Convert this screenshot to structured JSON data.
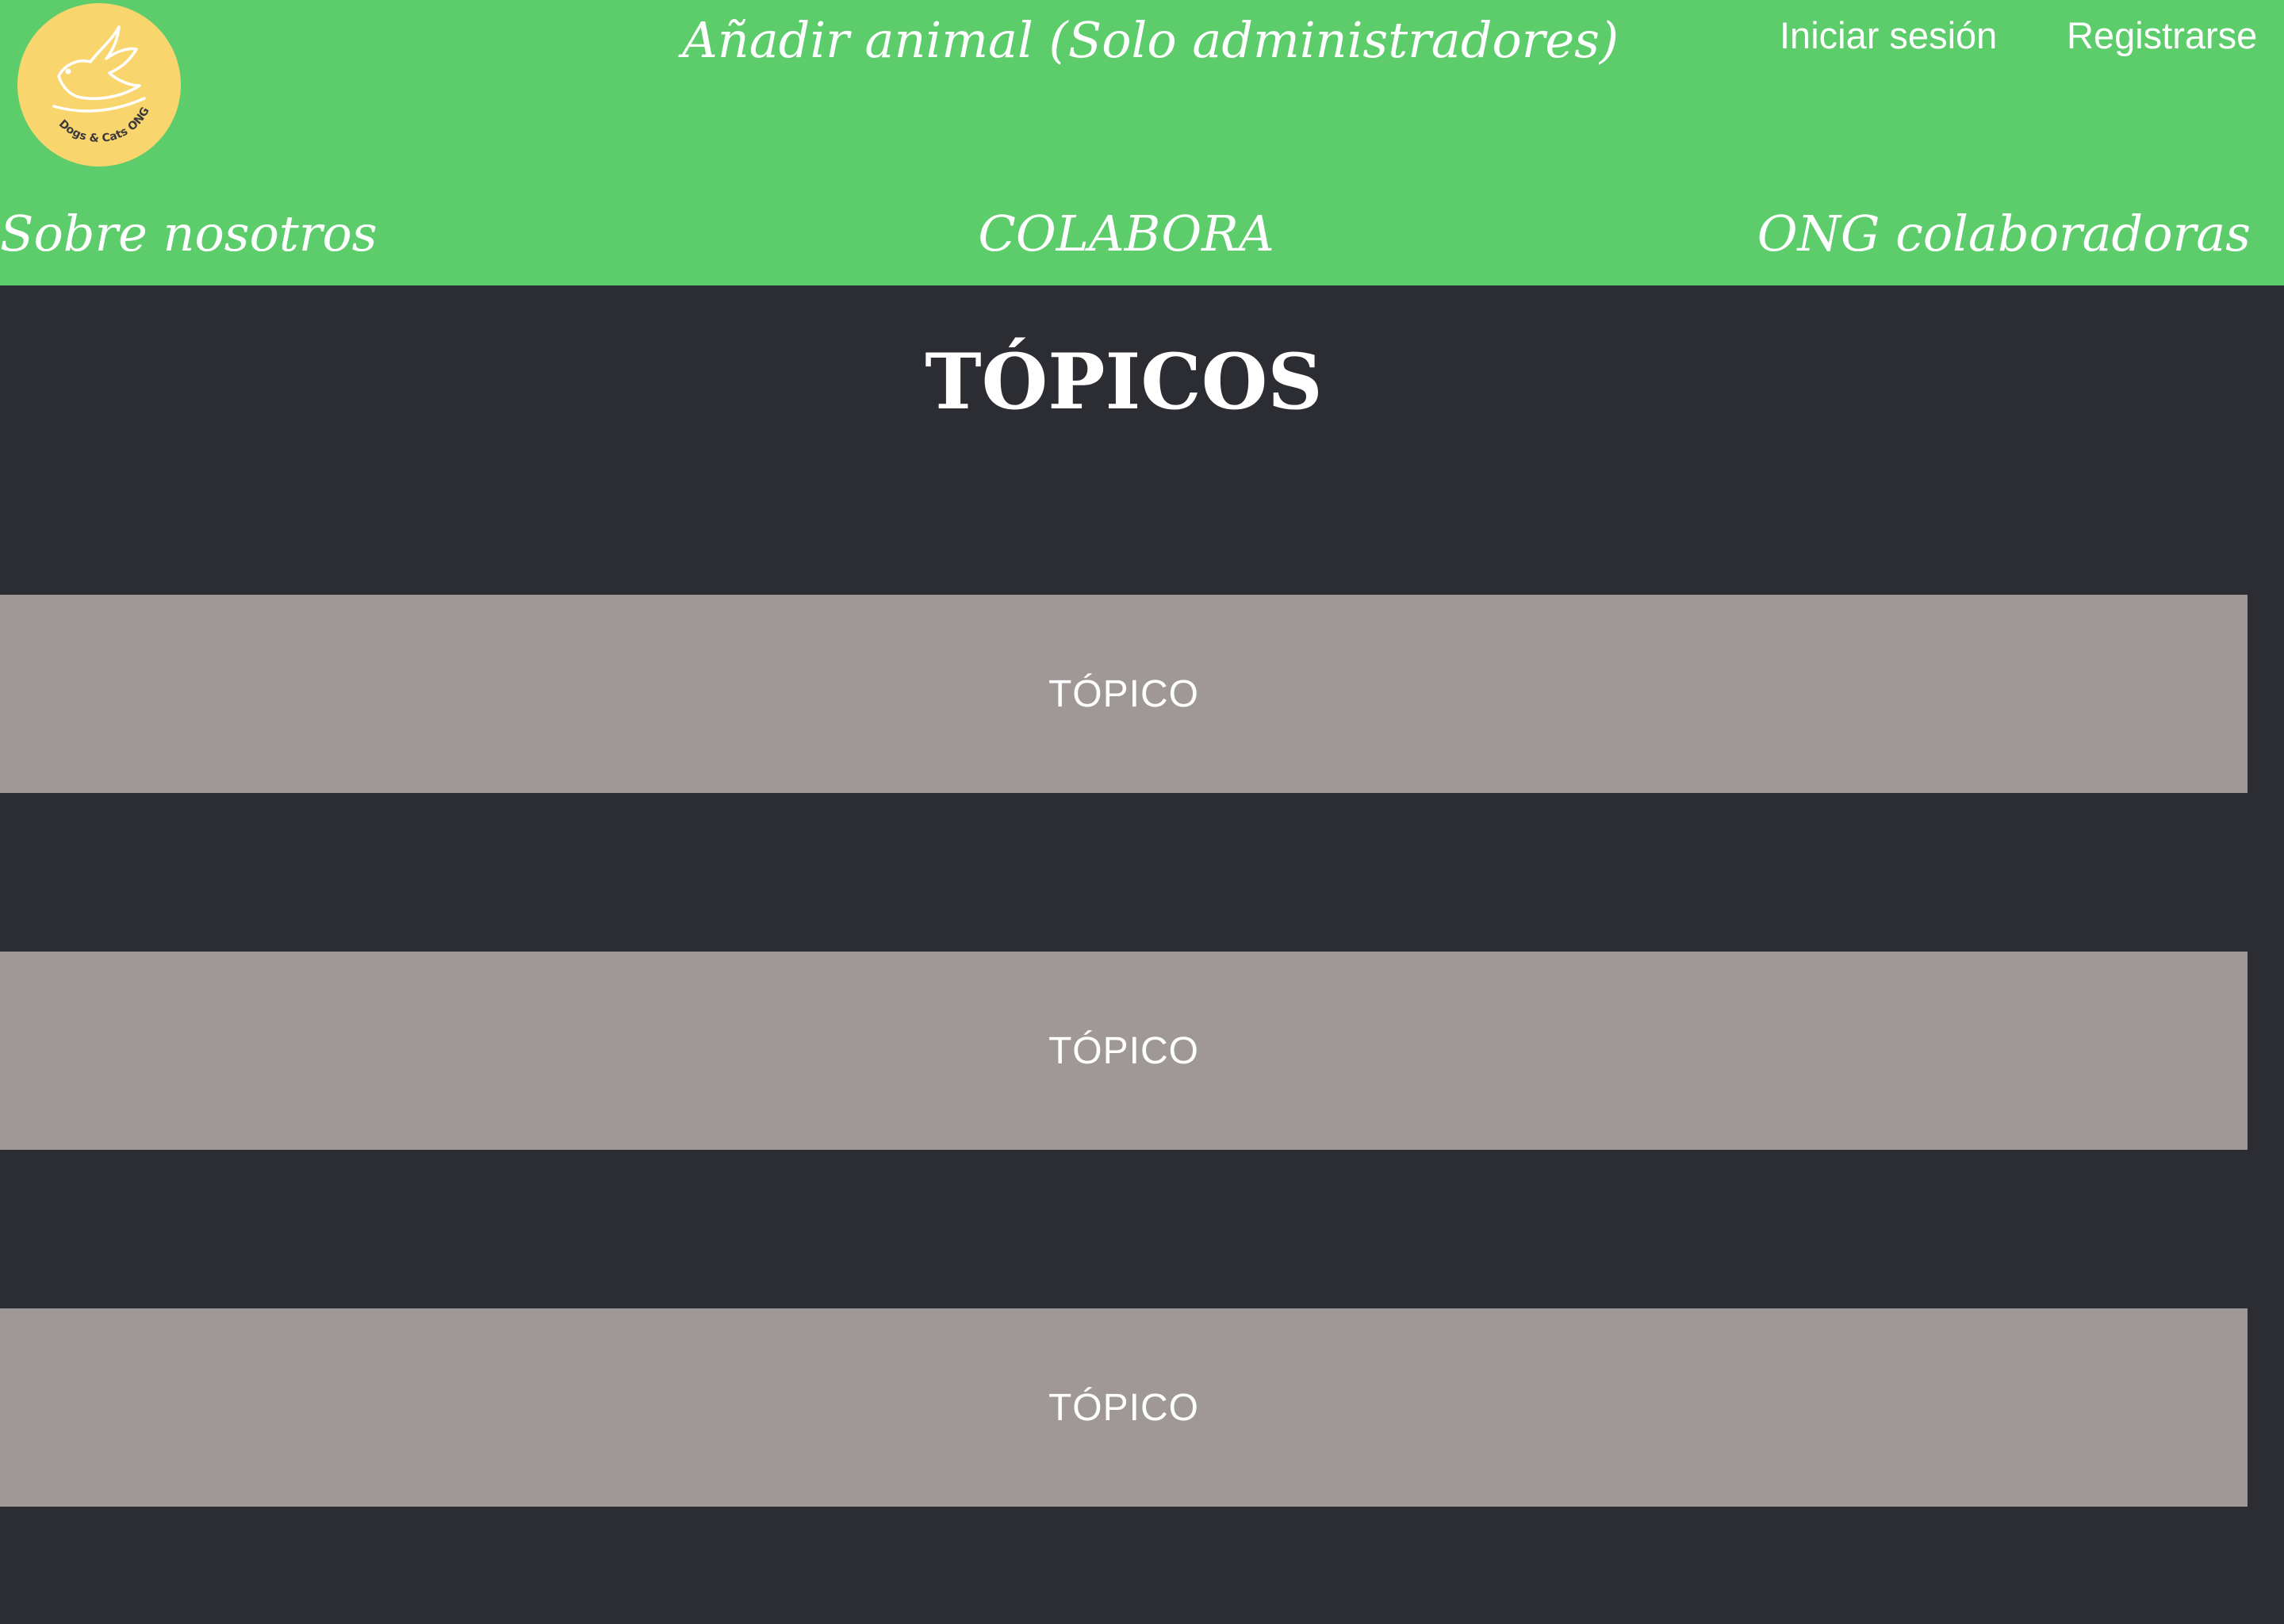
{
  "header": {
    "logo": {
      "icon": "dove-icon",
      "text": "Dogs & Cats ONG",
      "background": "#f9d56e"
    },
    "admin_link": "Añadir animal (Solo administradores)",
    "login_link": "Iniciar sesión",
    "register_link": "Registrarse",
    "nav": {
      "about": "Sobre nosotros",
      "collaborate": "COLABORA",
      "partner_ngos": "ONG colaboradoras"
    },
    "background": "#5dcc6b"
  },
  "main": {
    "title": "TÓPICOS",
    "topics": [
      {
        "label": "TÓPICO"
      },
      {
        "label": "TÓPICO"
      },
      {
        "label": "TÓPICO"
      }
    ],
    "background": "#2c2d33",
    "card_color": "#a09897"
  }
}
